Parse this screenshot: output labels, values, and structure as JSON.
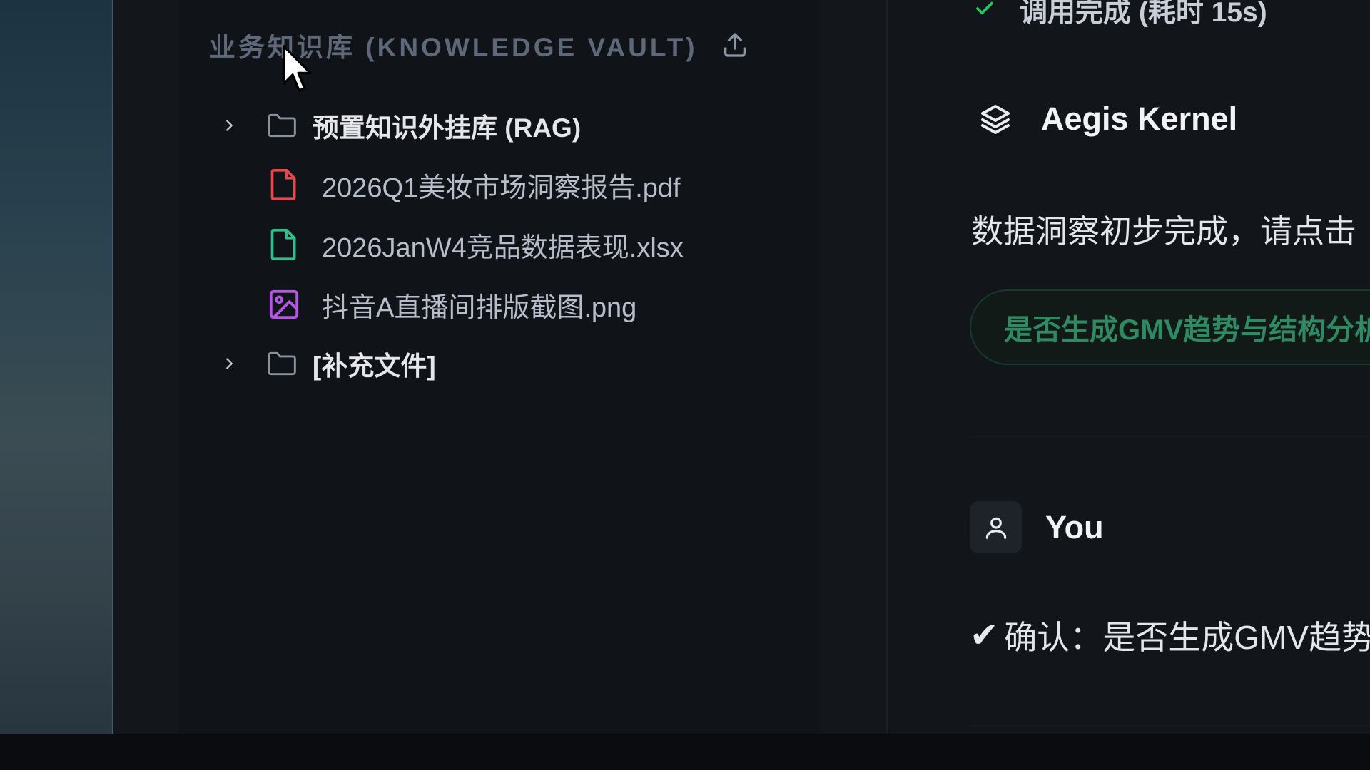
{
  "vault": {
    "title": "业务知识库 (KNOWLEDGE VAULT)",
    "upload_icon": "upload-icon",
    "folders": [
      {
        "label": "预置知识外挂库 (RAG)",
        "expanded": true
      },
      {
        "label": "[补充文件]",
        "expanded": false
      }
    ],
    "files": [
      {
        "name": "2026Q1美妆市场洞察报告.pdf",
        "icon": "pdf-file-icon",
        "color": "#e5484d"
      },
      {
        "name": "2026JanW4竞品数据表现.xlsx",
        "icon": "spreadsheet-file-icon",
        "color": "#2fbf8a"
      },
      {
        "name": "抖音A直播间排版截图.png",
        "icon": "image-file-icon",
        "color": "#b556e6"
      }
    ]
  },
  "chat": {
    "status_text": "调用完成 (耗时 15s)",
    "status_color": "#22c55e",
    "assistant_name": "Aegis Kernel",
    "assistant_message": "数据洞察初步完成，请点击",
    "suggestion": "是否生成GMV趋势与结构分析",
    "suggestion_color": "#2f8a64",
    "user_name": "You",
    "user_message_check": "✔",
    "user_message": "确认：是否生成GMV趋势"
  }
}
